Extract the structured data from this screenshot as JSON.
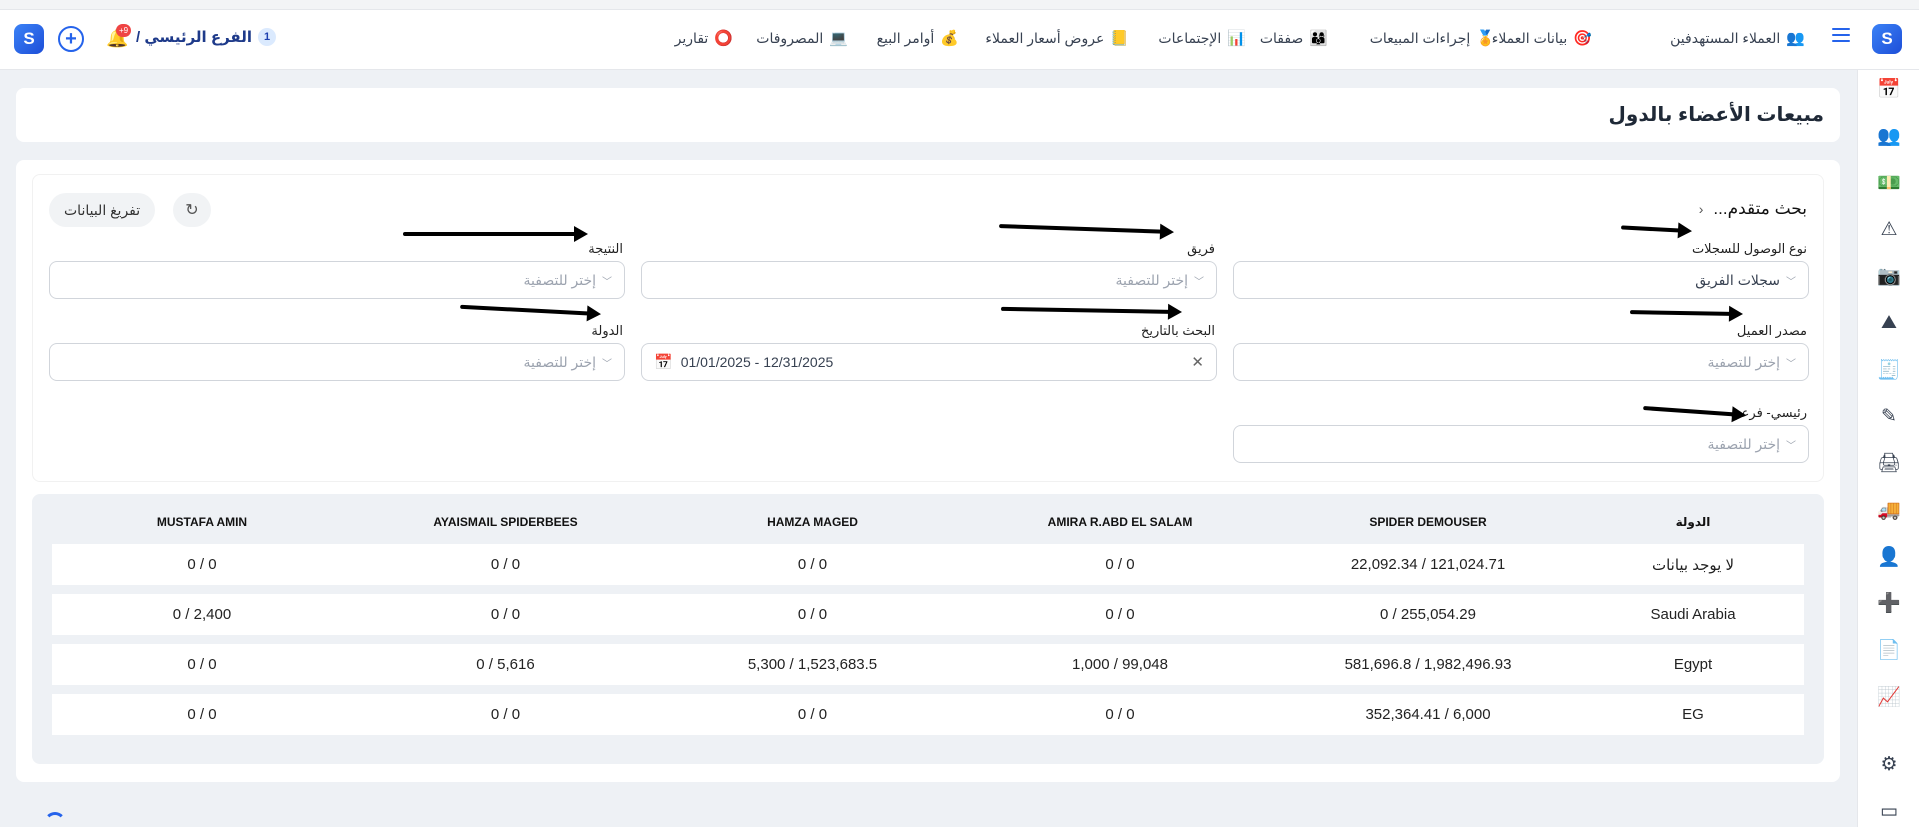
{
  "topbar": {
    "branch_number": "1",
    "branch_label": "الفرع الرئيسي /",
    "notifications_count": "+9",
    "nav": [
      {
        "label": "العملاء المستهدفين",
        "icon": "👥"
      },
      {
        "label": "بيانات العملاء",
        "icon": "🎯"
      },
      {
        "label": "إجراءات المبيعات",
        "icon": "🏅"
      },
      {
        "label": "صفقات",
        "icon": "👨‍👩‍👦"
      },
      {
        "label": "الإجتماعات",
        "icon": "📊"
      },
      {
        "label": "عروض أسعار العملاء",
        "icon": "📒"
      },
      {
        "label": "أوامر البيع",
        "icon": "💰"
      },
      {
        "label": "المصروفات",
        "icon": "💻"
      },
      {
        "label": "تقارير",
        "icon": "⭕"
      }
    ]
  },
  "page": {
    "title": "مبيعات الأعضاء بالدول"
  },
  "filters": {
    "advanced_search": "بحث متقدم...",
    "export_label": "تفريغ البيانات",
    "labels": {
      "access_type": "نوع الوصول للسجلات",
      "team": "فريق",
      "result": "النتيجة",
      "client_source": "مصدر العميل",
      "date_search": "البحث بالتاريخ",
      "country": "الدولة",
      "main_sub": "رئيسي- فرعي"
    },
    "values": {
      "access_type": "سجلات الفريق",
      "date_range": "01/01/2025 - 12/31/2025"
    },
    "placeholder": "إختر للتصفية"
  },
  "table": {
    "headers": [
      "الدولة",
      "SPIDER DEMOUSER",
      "AMIRA R.ABD EL SALAM",
      "HAMZA MAGED",
      "AYAISMAIL SPIDERBEES",
      "MUSTAFA AMIN"
    ],
    "rows": [
      [
        "لا يوجد بيانات",
        "121,024.71 / 22,092.34",
        "0 / 0",
        "0 / 0",
        "0 / 0",
        "0 / 0"
      ],
      [
        "Saudi Arabia",
        "255,054.29 / 0",
        "0 / 0",
        "0 / 0",
        "0 / 0",
        "2,400 / 0"
      ],
      [
        "Egypt",
        "1,982,496.93 / 581,696.8",
        "99,048 / 1,000",
        "1,523,683.5 / 5,300",
        "5,616 / 0",
        "0 / 0"
      ],
      [
        "EG",
        "6,000 / 352,364.41",
        "0 / 0",
        "0 / 0",
        "0 / 0",
        "0 / 0"
      ]
    ]
  },
  "sidebar_icons": [
    "calendar-plus-icon",
    "team-icon",
    "money-icon",
    "warning-icon",
    "camera-icon",
    "mountain-icon",
    "invoice-icon",
    "signature-icon",
    "printer-icon",
    "truck-icon",
    "user-settings-icon",
    "user-add-icon",
    "document-search-icon",
    "chart-icon",
    "gear-icon",
    "window-icon"
  ]
}
